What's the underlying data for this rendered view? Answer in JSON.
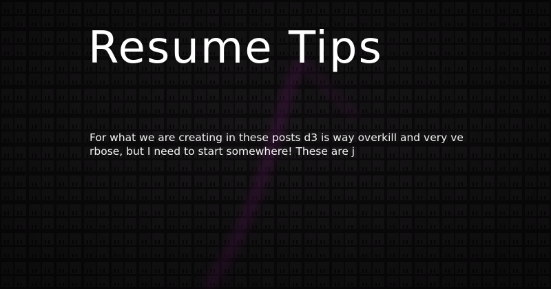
{
  "post": {
    "title": "Resume Tips",
    "excerpt": "For what we are creating in these posts d3 is way overkill and very verbose, but I need to start somewhere!  These are j"
  },
  "colors": {
    "background": "#151315",
    "pattern_tile": "#262426",
    "pattern_notch": "#0c0b0c",
    "accent_glow": "#8a1a8c",
    "text": "#ffffff"
  }
}
